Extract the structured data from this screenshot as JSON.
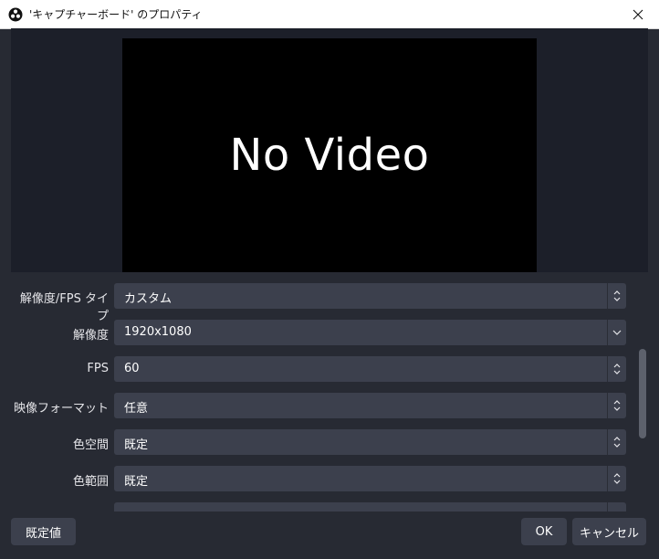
{
  "window": {
    "title": "'キャプチャーボード' のプロパティ",
    "app_icon": "obs-logo-icon",
    "close_icon": "close-icon"
  },
  "preview": {
    "message": "No Video"
  },
  "settings": {
    "fields": [
      {
        "label": "解像度/FPS タイプ",
        "value": "カスタム",
        "control": "updown"
      },
      {
        "label": "解像度",
        "value": "1920x1080",
        "control": "dropdown"
      },
      {
        "label": "FPS",
        "value": "60",
        "control": "updown"
      },
      {
        "label": "映像フォーマット",
        "value": "任意",
        "control": "updown"
      },
      {
        "label": "色空間",
        "value": "既定",
        "control": "updown"
      },
      {
        "label": "色範囲",
        "value": "既定",
        "control": "updown"
      }
    ]
  },
  "footer": {
    "defaults_label": "既定値",
    "ok_label": "OK",
    "cancel_label": "キャンセル"
  },
  "colors": {
    "background": "#272a33",
    "preview_background": "#1c1f29",
    "control": "#3c404d",
    "text": "#e6e6ea"
  }
}
